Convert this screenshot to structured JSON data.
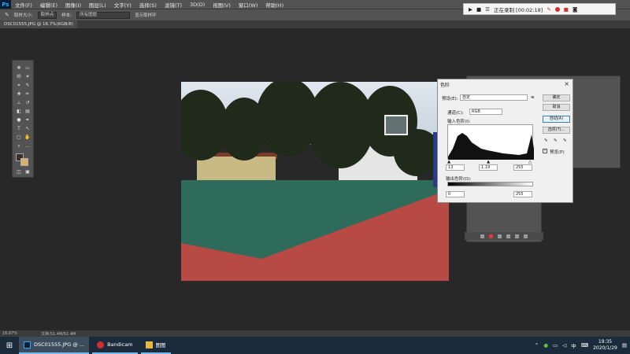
{
  "app": {
    "logo": "Ps",
    "menu": [
      "文件(F)",
      "编辑(E)",
      "图像(I)",
      "图层(L)",
      "文字(Y)",
      "选择(S)",
      "滤镜(T)",
      "3D(D)",
      "视图(V)",
      "窗口(W)",
      "帮助(H)"
    ]
  },
  "options": {
    "sample_size_label": "取样大小:",
    "sample_size_value": "取样点",
    "sample_label": "样本:",
    "sample_value": "所有图层",
    "show_ring_label": "显示取样环"
  },
  "recorder": {
    "status": "正在录制 [00:02:18]"
  },
  "document": {
    "tab": "DSC01555.JPG @ 16.7%(RGB/8)"
  },
  "levels_dialog": {
    "title": "色阶",
    "preset_label": "预设(E):",
    "preset_value": "自定",
    "channel_label": "通道(C):",
    "channel_value": "RGB",
    "input_label": "输入色阶(I):",
    "input_black": "13",
    "input_gamma": "1.19",
    "input_white": "255",
    "output_label": "输出色阶(O):",
    "output_black": "0",
    "output_white": "255",
    "buttons": {
      "ok": "确定",
      "cancel": "取消",
      "auto": "自动(A)",
      "options": "选项(T)..."
    },
    "preview_label": "预览(P)"
  },
  "status": {
    "zoom": "16.67%",
    "doc_size": "文档:51.4M/51.4M"
  },
  "taskbar": {
    "items": [
      {
        "label": "DSC01555.JPG @ ..."
      },
      {
        "label": "Bandicam"
      },
      {
        "label": "图图"
      }
    ],
    "ime": "中",
    "time": "19:35",
    "date": "2020/1/29"
  }
}
